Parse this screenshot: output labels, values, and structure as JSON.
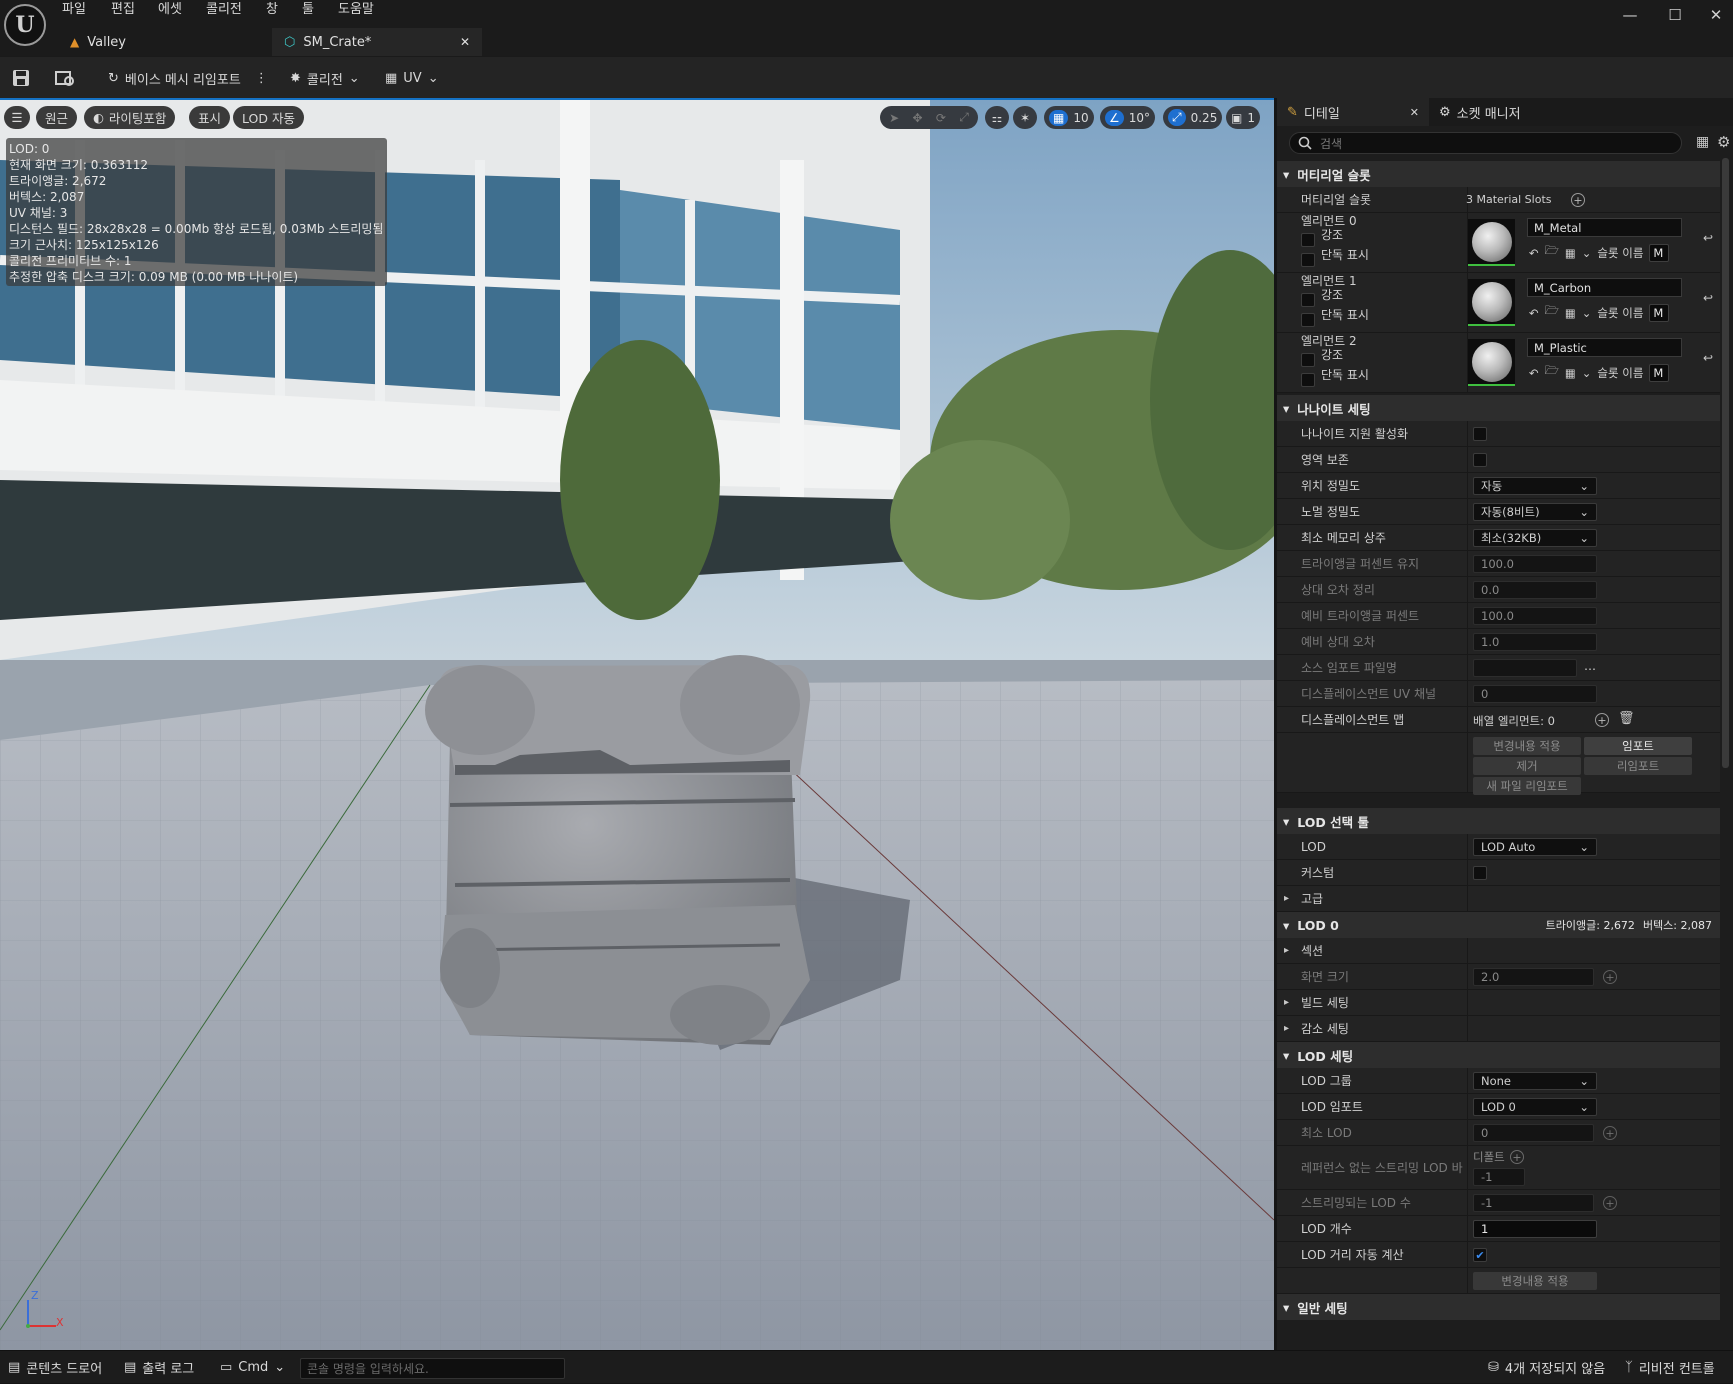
{
  "menu": [
    "파일",
    "편집",
    "에셋",
    "콜리전",
    "창",
    "툴",
    "도움말"
  ],
  "tabs": [
    {
      "label": "Valley"
    },
    {
      "label": "SM_Crate*"
    }
  ],
  "toolbar": {
    "reimport": "베이스 메시 리임포트",
    "collision": "콜리전",
    "uv": "UV"
  },
  "viewport": {
    "pills": [
      "원근",
      "라이팅포함",
      "표시",
      "LOD 자동"
    ],
    "grid_snap": "10",
    "rot_snap": "10°",
    "scale_snap": "0.25",
    "cam_speed": "1",
    "stats": [
      "LOD: 0",
      "현재 화면 크기: 0.363112",
      "트라이앵글: 2,672",
      "버텍스: 2,087",
      "UV 채널: 3",
      "디스턴스 필드: 28x28x28 = 0.00Mb 항상 로드됨, 0.03Mb 스트리밍됨",
      "크기 근사치: 125x125x126",
      "콜리전 프리미티브 수: 1",
      "추정한 압축 디스크 크기: 0.09 MB (0.00 MB 나나이트)"
    ],
    "axis": {
      "z": "Z",
      "x": "X"
    }
  },
  "panel": {
    "tab_details": "디테일",
    "tab_socket": "소켓 매니저",
    "search_placeholder": "검색",
    "mat_section": "머티리얼 슬롯",
    "mat_label": "머티리얼 슬롯",
    "mat_count": "3 Material Slots",
    "elements": [
      {
        "label": "엘리먼트 0",
        "highlight": "강조",
        "isolate": "단독 표시",
        "material": "M_Metal",
        "slot": "슬롯 이름",
        "slot_val": "M"
      },
      {
        "label": "엘리먼트 1",
        "highlight": "강조",
        "isolate": "단독 표시",
        "material": "M_Carbon",
        "slot": "슬롯 이름",
        "slot_val": "M"
      },
      {
        "label": "엘리먼트 2",
        "highlight": "강조",
        "isolate": "단독 표시",
        "material": "M_Plastic",
        "slot": "슬롯 이름",
        "slot_val": "M"
      }
    ],
    "nanite_section": "나나이트 세팅",
    "nanite_rows": [
      {
        "label": "나나이트 지원 활성화",
        "type": "cb"
      },
      {
        "label": "영역 보존",
        "type": "cb"
      },
      {
        "label": "위치 정밀도",
        "type": "dd",
        "value": "자동"
      },
      {
        "label": "노멀 정밀도",
        "type": "dd",
        "value": "자동(8비트)"
      },
      {
        "label": "최소 메모리 상주",
        "type": "dd",
        "value": "최소(32KB)"
      },
      {
        "label": "트라이앵글 퍼센트 유지",
        "type": "num",
        "value": "100.0",
        "dim": true
      },
      {
        "label": "상대 오차 정리",
        "type": "num",
        "value": "0.0",
        "dim": true
      },
      {
        "label": "예비 트라이앵글 퍼센트",
        "type": "num",
        "value": "100.0",
        "dim": true
      },
      {
        "label": "예비 상대 오차",
        "type": "num",
        "value": "1.0",
        "dim": true
      },
      {
        "label": "소스 임포트 파일명",
        "type": "file",
        "value": "",
        "dim": true
      },
      {
        "label": "디스플레이스먼트 UV 채널",
        "type": "num",
        "value": "0",
        "dim": true
      },
      {
        "label": "디스플레이스먼트 맵",
        "type": "arr",
        "value": "배열 엘리먼트: 0"
      }
    ],
    "nanite_buttons": [
      "변경내용 적용",
      "임포트",
      "제거",
      "리임포트",
      "새 파일 리임포트"
    ],
    "lodtool_section": "LOD 선택 툴",
    "lod_label": "LOD",
    "lod_value": "LOD Auto",
    "custom_label": "커스텀",
    "advanced": "고급",
    "lod0_section": "LOD 0",
    "lod0_tris": "트라이앵글: 2,672",
    "lod0_verts": "버텍스: 2,087",
    "sections": "섹션",
    "screen_size": "화면 크기",
    "screen_size_value": "2.0",
    "build_settings": "빌드 세팅",
    "reduction_settings": "감소 세팅",
    "lodsettings_section": "LOD 세팅",
    "lod_group": "LOD 그룹",
    "lod_group_value": "None",
    "lod_import": "LOD 임포트",
    "lod_import_value": "LOD 0",
    "min_lod": "최소 LOD",
    "min_lod_value": "0",
    "nostream_label": "레퍼런스 없는 스트리밍 LOD 바이",
    "default_label": "디폴트",
    "nostream_value": "-1",
    "stream_lod": "스트리밍되는 LOD 수",
    "stream_lod_value": "-1",
    "lod_count": "LOD 개수",
    "lod_count_value": "1",
    "auto_dist": "LOD 거리 자동 계산",
    "apply_changes": "변경내용 적용",
    "general_section": "일반 세팅"
  },
  "status": {
    "content_drawer": "콘텐츠 드로어",
    "output_log": "출력 로그",
    "cmd": "Cmd",
    "cmd_placeholder": "콘솔 명령을 입력하세요.",
    "unsaved": "4개 저장되지 않음",
    "revision": "리비전 컨트롤"
  }
}
